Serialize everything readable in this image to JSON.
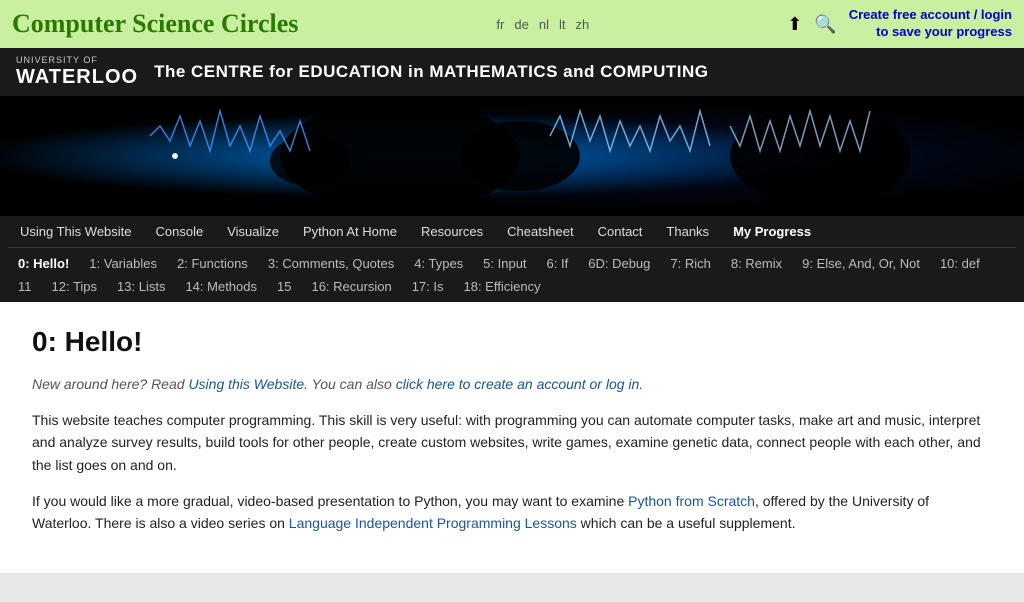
{
  "topbar": {
    "site_title": "Computer Science Circles",
    "languages": [
      "fr",
      "de",
      "nl",
      "lt",
      "zh"
    ],
    "create_account_text": "Create free account / login\nto save your progress",
    "upload_icon": "⬆",
    "search_icon": "🔍"
  },
  "uni_banner": {
    "waterloo_small": "UNIVERSITY OF",
    "waterloo_big": "WATERLOO",
    "tagline": "The CENTRE for EDUCATION in MATHEMATICS and COMPUTING"
  },
  "nav": {
    "main_items": [
      {
        "label": "Using This Website",
        "active": false
      },
      {
        "label": "Console",
        "active": false
      },
      {
        "label": "Visualize",
        "active": false
      },
      {
        "label": "Python At Home",
        "active": false
      },
      {
        "label": "Resources",
        "active": false
      },
      {
        "label": "Cheatsheet",
        "active": false
      },
      {
        "label": "Contact",
        "active": false
      },
      {
        "label": "Thanks",
        "active": false
      },
      {
        "label": "My Progress",
        "active": false
      }
    ],
    "sub_items": [
      {
        "label": "0: Hello!",
        "active": true
      },
      {
        "label": "1: Variables",
        "active": false
      },
      {
        "label": "2: Functions",
        "active": false
      },
      {
        "label": "3: Comments, Quotes",
        "active": false
      },
      {
        "label": "4: Types",
        "active": false
      },
      {
        "label": "5: Input",
        "active": false
      },
      {
        "label": "6: If",
        "active": false
      },
      {
        "label": "6D: Debug",
        "active": false
      },
      {
        "label": "7: Rich",
        "active": false
      },
      {
        "label": "8: Remix",
        "active": false
      },
      {
        "label": "9: Else, And, Or, Not",
        "active": false
      },
      {
        "label": "10: def",
        "active": false
      },
      {
        "label": "11",
        "active": false
      },
      {
        "label": "12: Tips",
        "active": false
      },
      {
        "label": "13: Lists",
        "active": false
      },
      {
        "label": "14: Methods",
        "active": false
      },
      {
        "label": "15",
        "active": false
      },
      {
        "label": "16: Recursion",
        "active": false
      },
      {
        "label": "17: Is",
        "active": false
      },
      {
        "label": "18: Efficiency",
        "active": false
      }
    ]
  },
  "content": {
    "heading": "0: Hello!",
    "intro_line": "New around here? Read ",
    "intro_link1_text": "Using this Website",
    "intro_middle": ". You can also ",
    "intro_link2_text": "click here to create an account or log in.",
    "para1": "This website teaches computer programming. This skill is very useful: with programming you can automate computer tasks, make art and music, interpret and analyze survey results, build tools for other people, create custom websites, write games, examine genetic data, connect people with each other, and the list goes on and on.",
    "para2_start": "If you would like a more gradual, video-based presentation to Python, you may want to examine ",
    "para2_link1": "Python from Scratch",
    "para2_middle": ", offered by the University of Waterloo. There is also a video series on ",
    "para2_link2": "Language Independent Programming Lessons",
    "para2_end": " which can be a useful supplement."
  }
}
